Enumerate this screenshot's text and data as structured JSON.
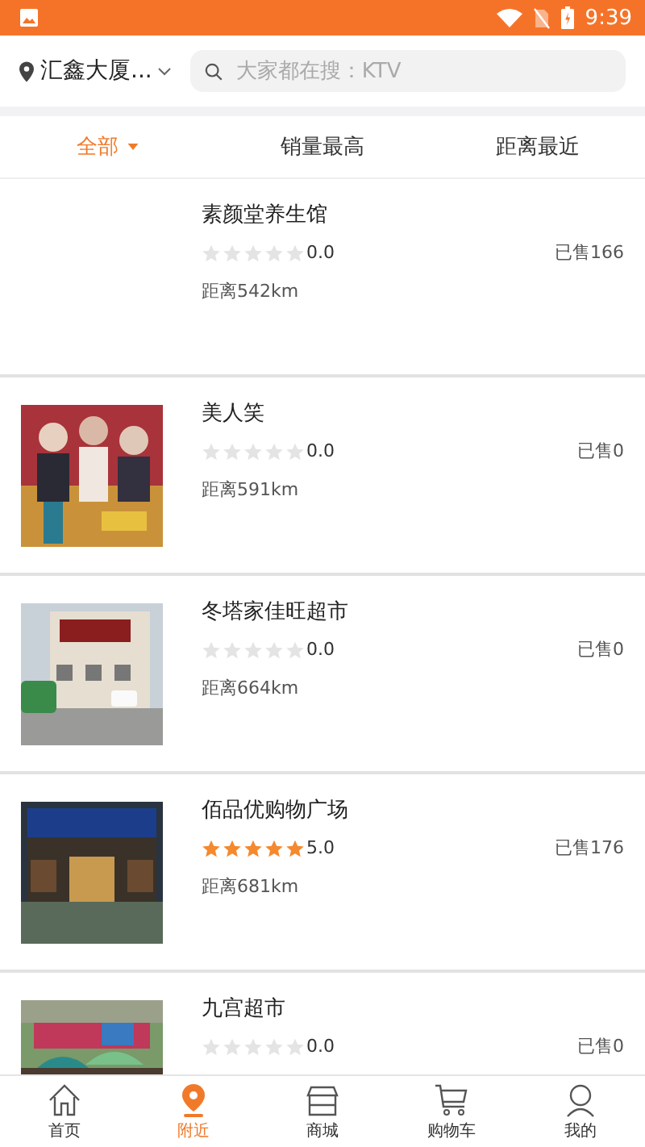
{
  "status_bar": {
    "time": "9:39"
  },
  "header": {
    "location": "汇鑫大厦...",
    "search": {
      "placeholder": "大家都在搜：KTV"
    }
  },
  "filters": [
    {
      "label": "全部",
      "selected": true,
      "dropdown": true
    },
    {
      "label": "销量最高",
      "selected": false
    },
    {
      "label": "距离最近",
      "selected": false
    }
  ],
  "shops": [
    {
      "name": "素颜堂养生馆",
      "stars": 0,
      "rating": "0.0",
      "sold": "已售166",
      "distance": "距离542km"
    },
    {
      "name": "美人笑",
      "stars": 0,
      "rating": "0.0",
      "sold": "已售0",
      "distance": "距离591km"
    },
    {
      "name": "冬塔家佳旺超市",
      "stars": 0,
      "rating": "0.0",
      "sold": "已售0",
      "distance": "距离664km"
    },
    {
      "name": "佰品优购物广场",
      "stars": 5,
      "rating": "5.0",
      "sold": "已售176",
      "distance": "距离681km"
    },
    {
      "name": "九宫超市",
      "stars": 0,
      "rating": "0.0",
      "sold": "已售0"
    }
  ],
  "tab_bar": [
    {
      "label": "首页",
      "kind": "home",
      "selected": false
    },
    {
      "label": "附近",
      "kind": "pin",
      "selected": true
    },
    {
      "label": "商城",
      "kind": "store",
      "selected": false
    },
    {
      "label": "购物车",
      "kind": "cart",
      "selected": false
    },
    {
      "label": "我的",
      "kind": "user",
      "selected": false
    }
  ]
}
